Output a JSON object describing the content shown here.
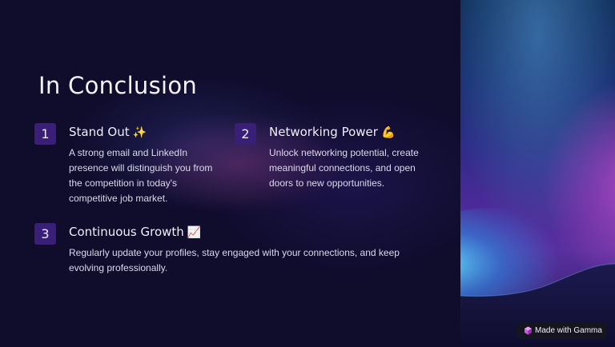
{
  "slide": {
    "title": "In Conclusion",
    "items": [
      {
        "number": "1",
        "title": "Stand Out",
        "emoji": "✨",
        "body": "A strong email and LinkedIn presence will distinguish you from the competition in today's competitive job market."
      },
      {
        "number": "2",
        "title": "Networking Power",
        "emoji": "💪",
        "body": "Unlock networking potential, create meaningful connections, and open doors to new opportunities."
      },
      {
        "number": "3",
        "title": "Continuous Growth",
        "emoji": "📈",
        "body": "Regularly update your profiles, stay engaged with your connections, and keep evolving professionally."
      }
    ]
  },
  "badge": {
    "label": "Made with Gamma",
    "icon": "gamma-logo-icon"
  },
  "colors": {
    "background": "#100c2c",
    "number_badge": "#3a1f78",
    "title_text": "#f3f1fb",
    "body_text": "#dcd8ec"
  }
}
